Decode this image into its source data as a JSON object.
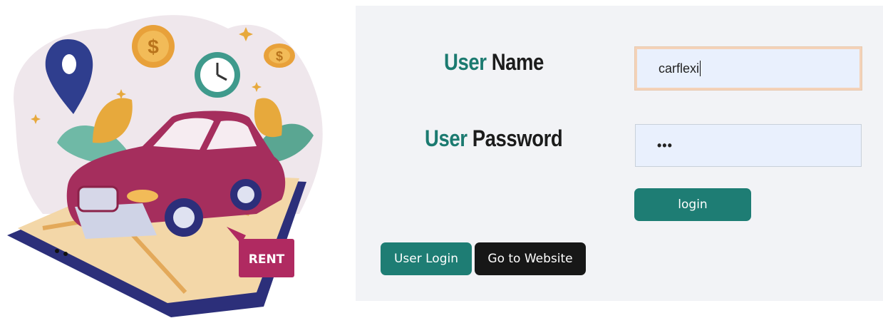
{
  "illustration": {
    "badge_text": "RENT",
    "icons": [
      "location-pin-icon",
      "dollar-coin-icon",
      "clock-icon",
      "car-icon",
      "phone-map-icon",
      "sparkle-icon"
    ]
  },
  "form": {
    "username_label_accent": "User",
    "username_label_rest": "Name",
    "username_value": "carflexi",
    "password_label_accent": "User",
    "password_label_rest": "Password",
    "password_value": "•••",
    "login_button": "login"
  },
  "footer_buttons": {
    "user_login": "User Login",
    "go_to_website": "Go to Website"
  },
  "colors": {
    "accent": "#1e7d74",
    "dark_button": "#171717",
    "panel_bg": "#f2f3f6",
    "input_bg": "#e9f0fd",
    "focus_border": "#f4d2b8",
    "rent_badge": "#b02a61"
  }
}
